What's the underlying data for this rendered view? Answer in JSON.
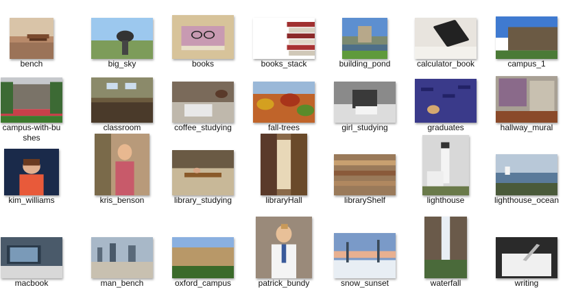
{
  "files": [
    {
      "name": "bench",
      "icon": "image-thumbnail-icon"
    },
    {
      "name": "big_sky",
      "icon": "image-thumbnail-icon"
    },
    {
      "name": "books",
      "icon": "image-thumbnail-icon"
    },
    {
      "name": "books_stack",
      "icon": "image-thumbnail-icon"
    },
    {
      "name": "building_pond",
      "icon": "image-thumbnail-icon"
    },
    {
      "name": "calculator_book",
      "icon": "image-thumbnail-icon"
    },
    {
      "name": "campus_1",
      "icon": "image-thumbnail-icon"
    },
    {
      "name": "campus-with-bu shes",
      "icon": "image-thumbnail-icon"
    },
    {
      "name": "classroom",
      "icon": "image-thumbnail-icon"
    },
    {
      "name": "coffee_studying",
      "icon": "image-thumbnail-icon"
    },
    {
      "name": "fall-trees",
      "icon": "image-thumbnail-icon"
    },
    {
      "name": "girl_studying",
      "icon": "image-thumbnail-icon"
    },
    {
      "name": "graduates",
      "icon": "image-thumbnail-icon"
    },
    {
      "name": "hallway_mural",
      "icon": "image-thumbnail-icon"
    },
    {
      "name": "kim_williams",
      "icon": "image-thumbnail-icon"
    },
    {
      "name": "kris_benson",
      "icon": "image-thumbnail-icon"
    },
    {
      "name": "library_studying",
      "icon": "image-thumbnail-icon"
    },
    {
      "name": "libraryHall",
      "icon": "image-thumbnail-icon"
    },
    {
      "name": "libraryShelf",
      "icon": "image-thumbnail-icon"
    },
    {
      "name": "lighthouse",
      "icon": "image-thumbnail-icon"
    },
    {
      "name": "lighthouse_ocean",
      "icon": "image-thumbnail-icon"
    },
    {
      "name": "macbook",
      "icon": "image-thumbnail-icon"
    },
    {
      "name": "man_bench",
      "icon": "image-thumbnail-icon"
    },
    {
      "name": "oxford_campus",
      "icon": "image-thumbnail-icon"
    },
    {
      "name": "patrick_bundy",
      "icon": "image-thumbnail-icon"
    },
    {
      "name": "snow_sunset",
      "icon": "image-thumbnail-icon"
    },
    {
      "name": "waterfall",
      "icon": "image-thumbnail-icon"
    },
    {
      "name": "writing",
      "icon": "image-thumbnail-icon"
    }
  ]
}
